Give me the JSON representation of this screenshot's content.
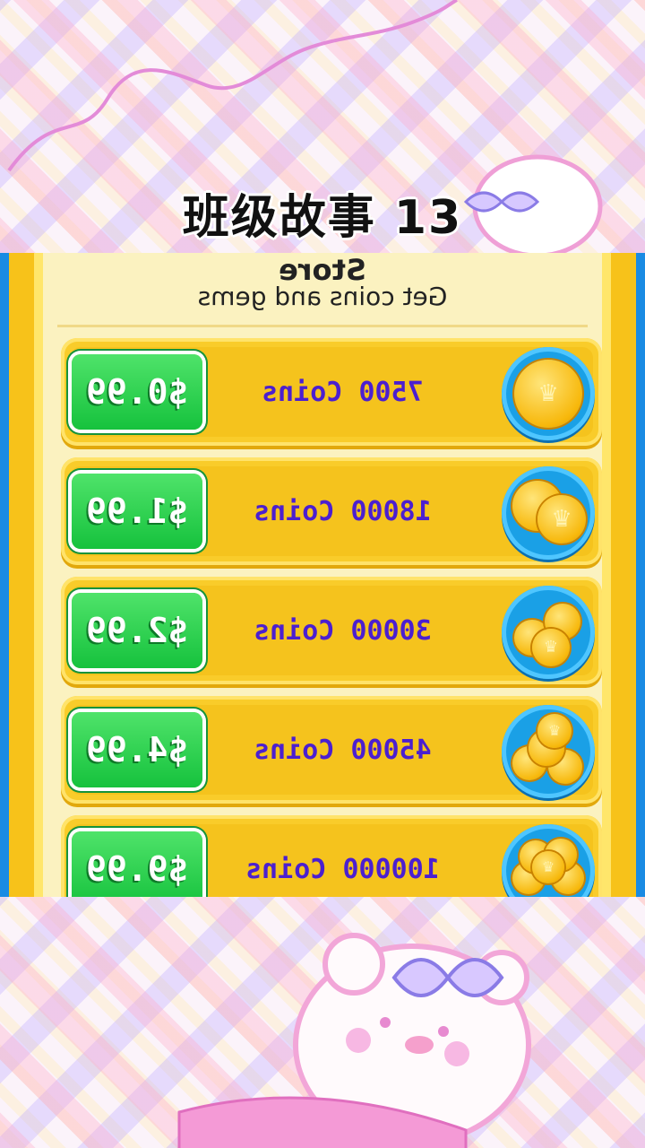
{
  "title": "班级故事 13",
  "store": {
    "title": "Store",
    "subtitle": "Get coins and gems",
    "items": [
      {
        "label": "7500 Coins",
        "price": "$0.99",
        "icon": "single-coin-icon"
      },
      {
        "label": "18000 Coins",
        "price": "$1.99",
        "icon": "coin-pair-icon"
      },
      {
        "label": "30000 Coins",
        "price": "$2.99",
        "icon": "coin-pile-icon"
      },
      {
        "label": "45000 Coins",
        "price": "$4.99",
        "icon": "coin-stack-icon"
      },
      {
        "label": "100000 Coins",
        "price": "$9.99",
        "icon": "coin-heap-icon"
      }
    ]
  },
  "colors": {
    "frame_blue": "#1a8be3",
    "panel_yellow": "#f5c31d",
    "button_green": "#16c23d",
    "label_purple": "#4b1fd0"
  }
}
